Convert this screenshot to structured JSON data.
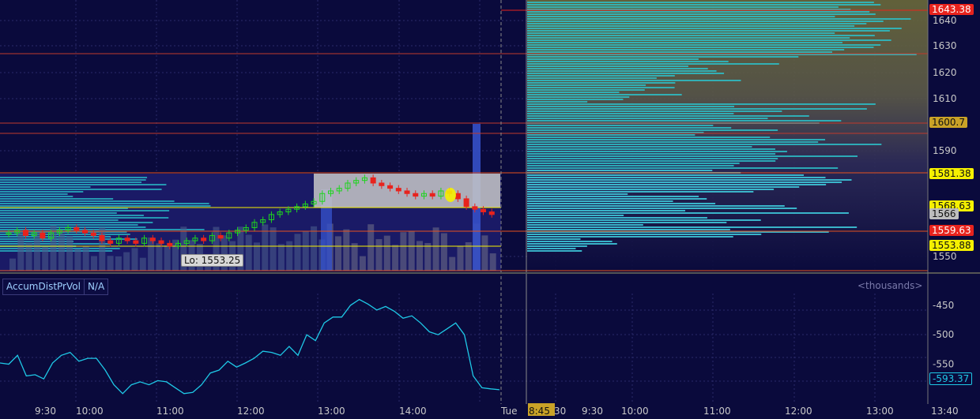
{
  "price_axis": {
    "ticks": [
      "1640",
      "1630",
      "1620",
      "1610",
      "1590",
      "1550"
    ],
    "badges": [
      {
        "text": "1643.38",
        "color": "#e8231d",
        "fg": "#ffffff"
      },
      {
        "text": "1600.7",
        "color": "#c9a227",
        "fg": "#111111"
      },
      {
        "text": "1581.38",
        "color": "#f5f000",
        "fg": "#111111"
      },
      {
        "text": "1568.63",
        "color": "#f5f000",
        "fg": "#111111"
      },
      {
        "text": "1566",
        "color": "#bdbdbd",
        "fg": "#111111"
      },
      {
        "text": "1559.63",
        "color": "#e8231d",
        "fg": "#ffffff"
      },
      {
        "text": "1553.88",
        "color": "#f5f000",
        "fg": "#111111"
      }
    ]
  },
  "low_label": "Lo: 1553.25",
  "study": {
    "name": "AccumDistPrVol",
    "value_label": "N/A",
    "units_label": "<thousands>",
    "ticks": [
      "-450",
      "-500",
      "-550"
    ],
    "current_value": "-593.37",
    "current_color": "#1ec8e6",
    "line_color": "#1ec8e6"
  },
  "time_axis": {
    "labels": [
      "9:30",
      "10:00",
      "11:00",
      "12:00",
      "13:00",
      "14:00",
      "Tue",
      "8:45",
      "30",
      "9:30",
      "10:00",
      "11:00",
      "12:00",
      "13:00",
      "13:40"
    ],
    "highlight": "8:45"
  },
  "chart_data": {
    "type": "line",
    "title": "",
    "series": [
      {
        "values": [
          -548,
          -550,
          -535,
          -570,
          -568,
          -575,
          -548,
          -535,
          -530,
          -545,
          -540,
          -540,
          -560,
          -585,
          -600,
          -585,
          -580,
          -585,
          -578,
          -580,
          -590,
          -600,
          -598,
          -585,
          -565,
          -560,
          -545,
          -555,
          -548,
          -540,
          -528,
          -530,
          -535,
          -520,
          -535,
          -500,
          -510,
          -480,
          -470,
          -470,
          -450,
          -440,
          -448,
          -458,
          -452,
          -460,
          -472,
          -468,
          -480,
          -495,
          -500,
          -490,
          -480,
          -500,
          -570,
          -590,
          -592,
          -593.37
        ]
      }
    ],
    "ylim": [
      -615,
      -430
    ],
    "price": {
      "candles": [
        1559,
        1560,
        1558,
        1559,
        1557,
        1559,
        1560,
        1561,
        1560,
        1559,
        1558,
        1556,
        1555,
        1557,
        1556,
        1555,
        1557,
        1556,
        1555,
        1554,
        1555,
        1556,
        1557,
        1556,
        1558,
        1557,
        1559,
        1560,
        1561,
        1563,
        1564,
        1566,
        1567,
        1568,
        1569,
        1570,
        1571,
        1574,
        1575,
        1576,
        1578,
        1579,
        1580,
        1578,
        1577,
        1576,
        1575,
        1574,
        1573,
        1574,
        1573,
        1575,
        1574,
        1572,
        1569,
        1568,
        1567,
        1566
      ],
      "price_range": [
        1545,
        1650
      ]
    }
  }
}
